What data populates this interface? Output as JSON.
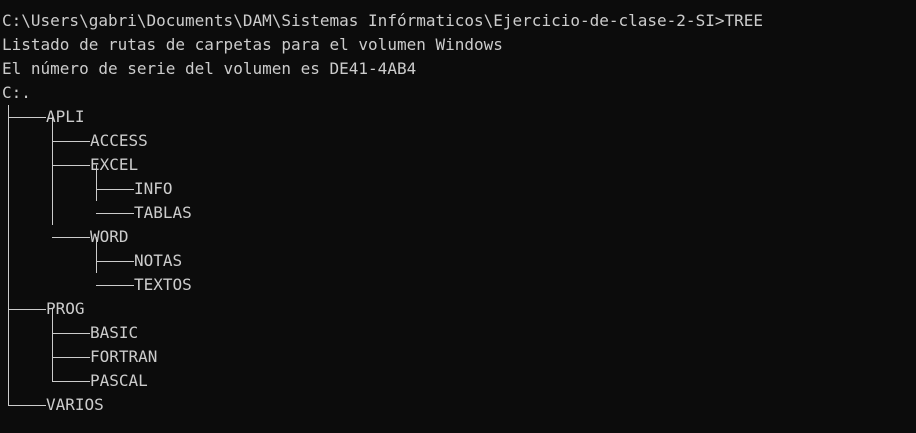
{
  "console": {
    "prompt_line": "C:\\Users\\gabri\\Documents\\DAM\\Sistemas Infórmaticos\\Ejercicio-de-clase-2-SI>TREE",
    "header_line_1": "Listado de rutas de carpetas para el volumen Windows",
    "header_line_2": "El número de serie del volumen es DE41-4AB4",
    "root": "C:.",
    "tree": [
      {
        "label": "APLI"
      },
      {
        "label": "ACCESS"
      },
      {
        "label": "EXCEL"
      },
      {
        "label": "INFO"
      },
      {
        "label": "TABLAS"
      },
      {
        "label": "WORD"
      },
      {
        "label": "NOTAS"
      },
      {
        "label": "TEXTOS"
      },
      {
        "label": "PROG"
      },
      {
        "label": "BASIC"
      },
      {
        "label": "FORTRAN"
      },
      {
        "label": "PASCAL"
      },
      {
        "label": "VARIOS"
      }
    ]
  }
}
